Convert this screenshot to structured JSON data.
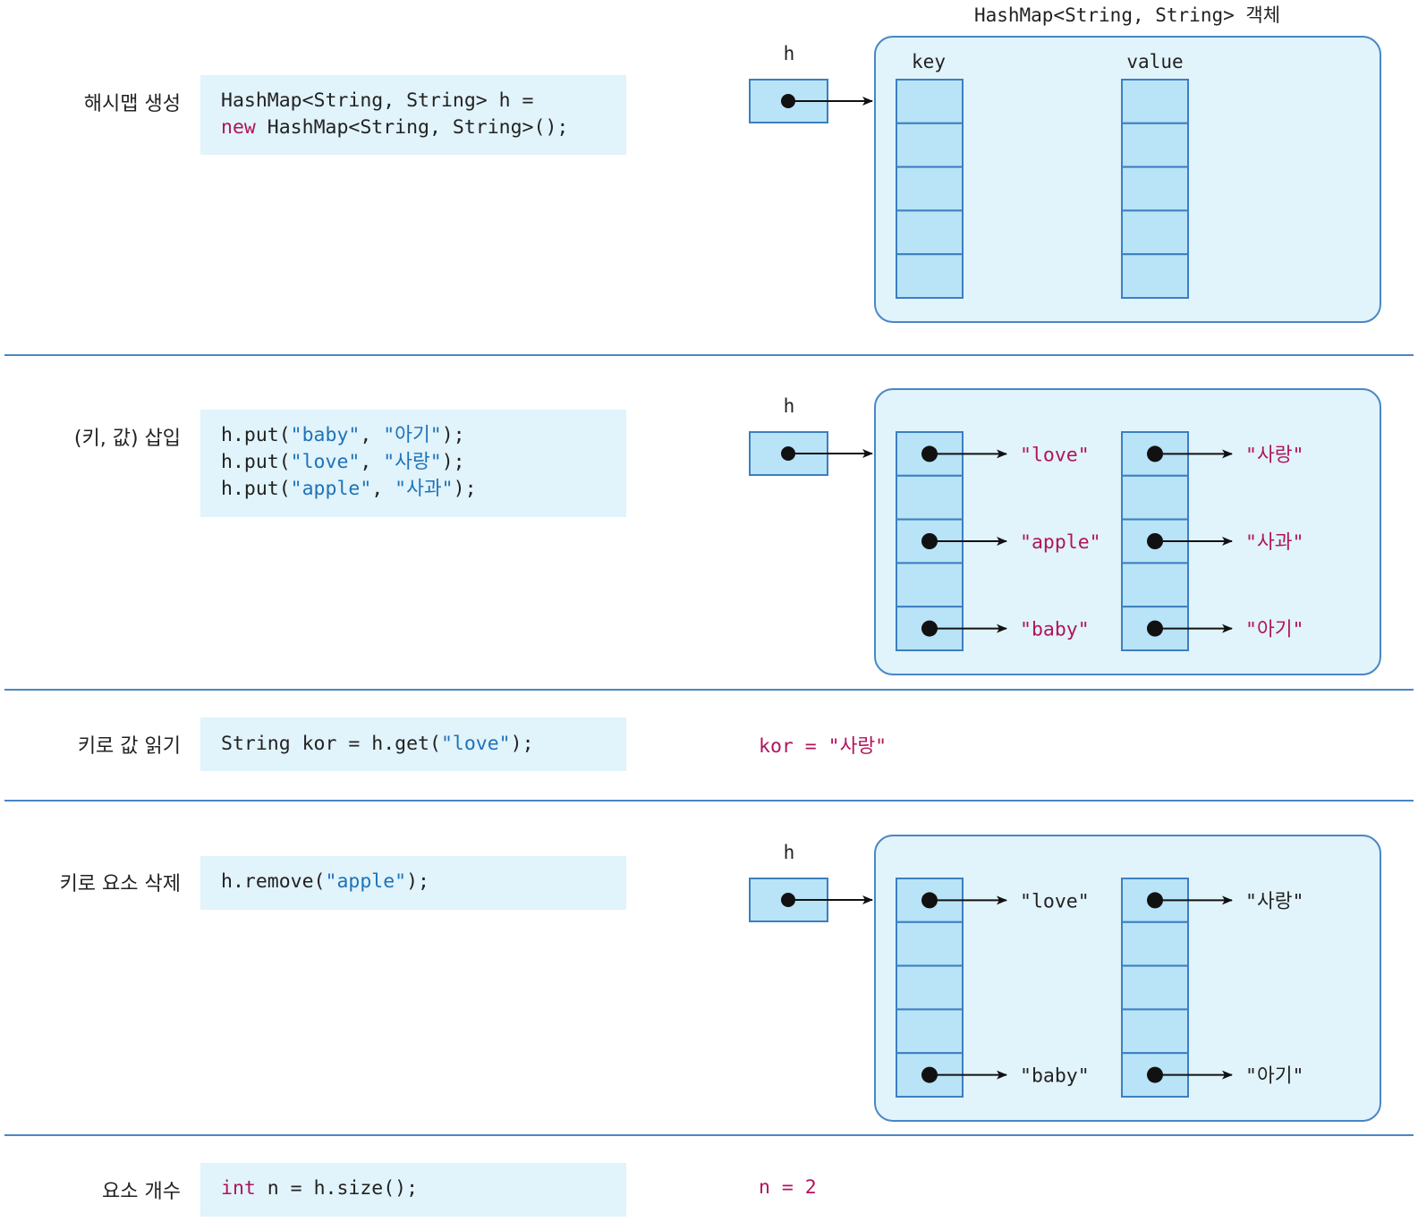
{
  "object_title": "HashMap<String, String> 객체",
  "column_headers": {
    "key": "key",
    "value": "value"
  },
  "ref_name": "h",
  "sections": [
    {
      "label": "해시맵 생성",
      "code_lines": [
        [
          {
            "t": "HashMap<String, String> h =",
            "c": "plain"
          }
        ],
        [
          {
            "t": "new",
            "c": "kw"
          },
          {
            "t": " HashMap<String, String>();",
            "c": "plain"
          }
        ]
      ]
    },
    {
      "label": "(키, 값) 삽입",
      "code_lines": [
        [
          {
            "t": "h.put(",
            "c": "plain"
          },
          {
            "t": "\"baby\"",
            "c": "str"
          },
          {
            "t": ", ",
            "c": "plain"
          },
          {
            "t": "\"아기\"",
            "c": "str"
          },
          {
            "t": ");",
            "c": "plain"
          }
        ],
        [
          {
            "t": "h.put(",
            "c": "plain"
          },
          {
            "t": "\"love\"",
            "c": "str"
          },
          {
            "t": ", ",
            "c": "plain"
          },
          {
            "t": "\"사랑\"",
            "c": "str"
          },
          {
            "t": ");",
            "c": "plain"
          }
        ],
        [
          {
            "t": "h.put(",
            "c": "plain"
          },
          {
            "t": "\"apple\"",
            "c": "str"
          },
          {
            "t": ", ",
            "c": "plain"
          },
          {
            "t": "\"사과\"",
            "c": "str"
          },
          {
            "t": ");",
            "c": "plain"
          }
        ]
      ],
      "entries": [
        {
          "slot": 0,
          "key": "\"love\"",
          "value": "\"사랑\""
        },
        {
          "slot": 2,
          "key": "\"apple\"",
          "value": "\"사과\""
        },
        {
          "slot": 4,
          "key": "\"baby\"",
          "value": "\"아기\""
        }
      ]
    },
    {
      "label": "키로 값 읽기",
      "code_lines": [
        [
          {
            "t": "String kor = h.get(",
            "c": "plain"
          },
          {
            "t": "\"love\"",
            "c": "str"
          },
          {
            "t": ");",
            "c": "plain"
          }
        ]
      ],
      "result": "kor = \"사랑\""
    },
    {
      "label": "키로 요소 삭제",
      "code_lines": [
        [
          {
            "t": "h.remove(",
            "c": "plain"
          },
          {
            "t": "\"apple\"",
            "c": "str"
          },
          {
            "t": ");",
            "c": "plain"
          }
        ]
      ],
      "entries": [
        {
          "slot": 0,
          "key": "\"love\"",
          "value": "\"사랑\""
        },
        {
          "slot": 4,
          "key": "\"baby\"",
          "value": "\"아기\""
        }
      ]
    },
    {
      "label": "요소 개수",
      "code_lines": [
        [
          {
            "t": "int",
            "c": "kw"
          },
          {
            "t": " n = h.size();",
            "c": "plain"
          }
        ]
      ],
      "result": "n = 2"
    }
  ],
  "colors": {
    "cell_fill": "#b9e3f7",
    "cell_stroke": "#3c7fc0",
    "panel_fill": "#e1f3fb",
    "panel_stroke": "#4a86c5",
    "code_bg": "#e1f3fb",
    "keyword": "#b0145c",
    "string_literal": "#1d73b8",
    "highlight_text": "#b0145c"
  }
}
